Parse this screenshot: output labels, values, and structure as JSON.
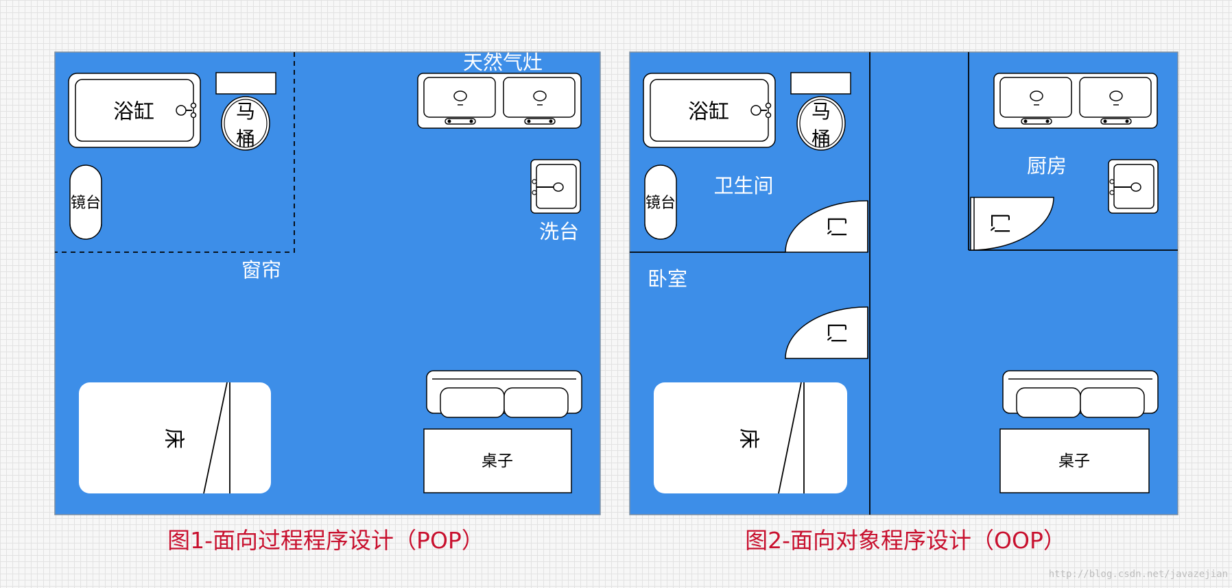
{
  "plan1": {
    "caption": "图1-面向过程程序设计（POP）",
    "labels": {
      "bathtub": "浴缸",
      "toilet_line1": "马",
      "toilet_line2": "桶",
      "mirror": "镜台",
      "gas_stove": "天然气灶",
      "sink": "洗台",
      "curtain": "窗帘",
      "bed": "床",
      "table": "桌子"
    }
  },
  "plan2": {
    "caption": "图2-面向对象程序设计（OOP）",
    "labels": {
      "bathtub": "浴缸",
      "toilet_line1": "马",
      "toilet_line2": "桶",
      "mirror": "镜台",
      "bathroom": "卫生间",
      "kitchen": "厨房",
      "bedroom": "卧室",
      "door": "门",
      "bed": "床",
      "table": "桌子"
    }
  },
  "watermark": "http://blog.csdn.net/javazejian",
  "colors": {
    "floor": "#3d8ee8",
    "caption": "#c8102e"
  }
}
